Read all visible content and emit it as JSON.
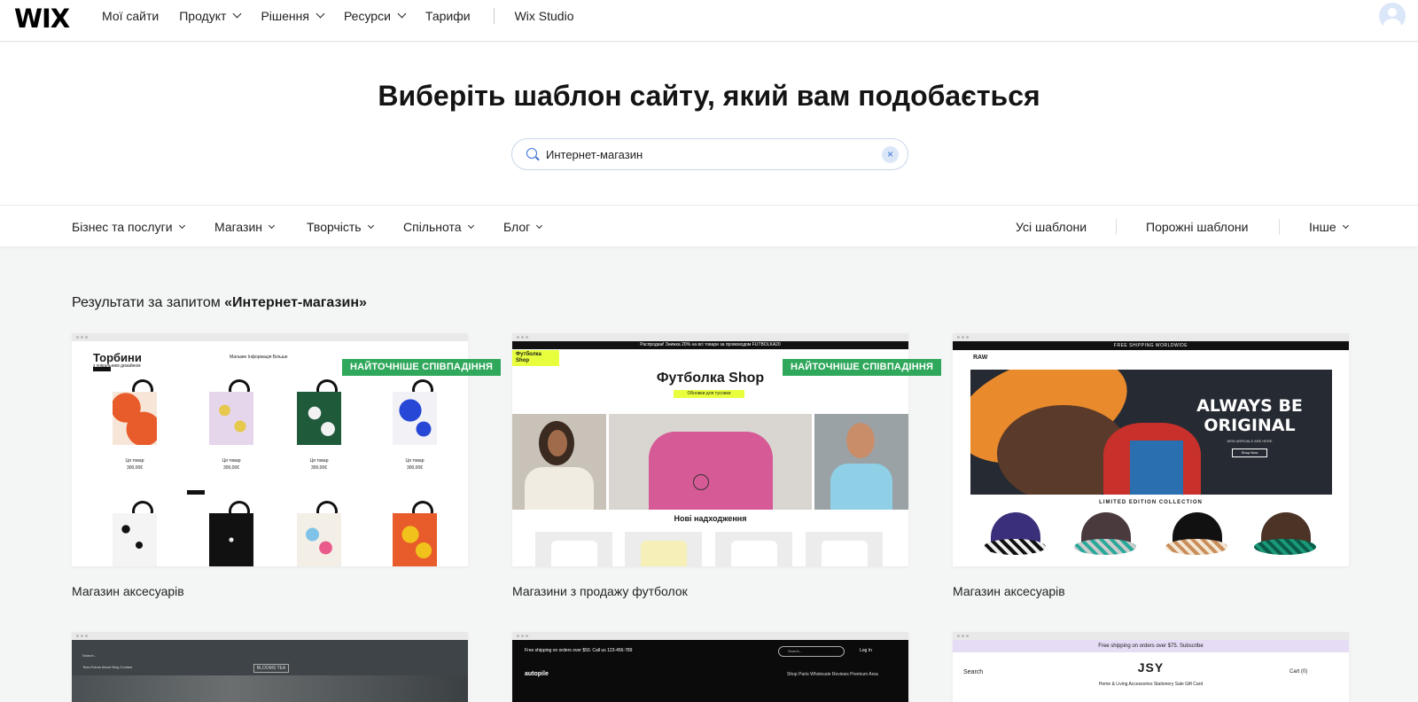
{
  "nav": {
    "logo": "WIX",
    "links": [
      "Мої сайти",
      "Продукт",
      "Рішення",
      "Ресурси",
      "Тарифи"
    ],
    "studio": "Wix Studio"
  },
  "hero": {
    "title": "Виберіть шаблон сайту, який вам подобається",
    "search_value": "Интернет-магазин",
    "clear": "×"
  },
  "filters": {
    "left": [
      "Бізнес та послуги",
      "Магазин",
      "Творчість",
      "Спільнота",
      "Блог"
    ],
    "right": [
      "Усі шаблони",
      "Порожні шаблони",
      "Інше"
    ]
  },
  "results": {
    "prefix": "Результати за запитом ",
    "query": "«Интернет-магазин»"
  },
  "cards": [
    {
      "label": "Магазин аксесуарів",
      "badge": "НАЙТОЧНІШЕ СПІВПАДІННЯ",
      "preview": {
        "title": "Торбини",
        "subtitle": "з унікальним дизайном",
        "menu": "Магазин    Інформація    Більше",
        "product": "Ця товар",
        "price": "300,00€"
      }
    },
    {
      "label": "Магазини з продажу футболок",
      "badge": "НАЙТОЧНІШЕ СПІВПАДІННЯ",
      "preview": {
        "promo": "Распродаж! Знижка 20% на всі товари за промокодом FUTBOLKA20",
        "logo": "Футболка Shop",
        "title": "Футболка Shop",
        "pill": "Обновки для тусовки",
        "section": "Нові надходження"
      }
    },
    {
      "label": "Магазин аксесуарів",
      "preview": {
        "ship": "FREE SHIPPING WORLDWIDE",
        "logo": "RAW",
        "headline": "ALWAYS BE ORIGINAL",
        "small": "NEW ARRIVALS ARE HERE",
        "button": "Shop Now",
        "collection": "LIMITED EDITION COLLECTION"
      }
    },
    {
      "preview": {
        "search": "Search...",
        "menu": "Teas    Extras    About    Blog    Contact",
        "tag": "BLOOMS TEA"
      }
    },
    {
      "preview": {
        "ship": "Free shipping on orders over $50. Call us 123-456-789",
        "search": "Search...",
        "login": "Log In",
        "logo": "autopile",
        "menu": "Shop Parts    Wholesale    Reviews    Premium Area"
      }
    },
    {
      "preview": {
        "ship": "Free shipping on orders over $75. Subscribe",
        "brand": "JSY",
        "search": "Search",
        "cart": "Cart (0)",
        "menu": "Home & Living    Accessories    Stationery    Sale    Gift Card"
      }
    }
  ],
  "colors": {
    "accent_blue": "#3b6fd6",
    "badge_green": "#2fa85b",
    "page_bg": "#f4f5f5",
    "lime": "#e8ff3d"
  }
}
